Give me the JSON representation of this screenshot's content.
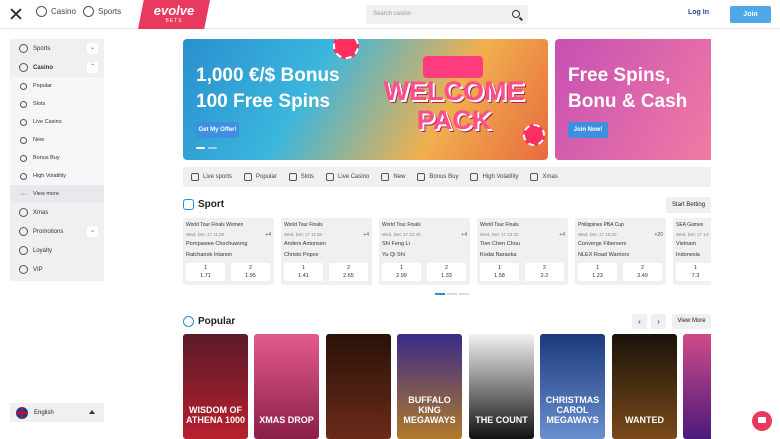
{
  "header": {
    "nav": [
      {
        "label": "Casino",
        "icon": "casino-icon"
      },
      {
        "label": "Sports",
        "icon": "sports-icon"
      }
    ],
    "logo": {
      "line1": "evolve",
      "line2": "BETS"
    },
    "search_placeholder": "Search casino",
    "login_label": "Log In",
    "join_label": "Join"
  },
  "sidebar": {
    "items": [
      {
        "label": "Sports",
        "icon": "sports-icon",
        "expand": "⌄"
      },
      {
        "label": "Casino",
        "icon": "casino-icon",
        "expand": "⌃"
      },
      {
        "label": "Popular",
        "icon": "popular-icon"
      },
      {
        "label": "Slots",
        "icon": "slots-icon"
      },
      {
        "label": "Live Casino",
        "icon": "live-casino-icon"
      },
      {
        "label": "New",
        "icon": "new-icon"
      },
      {
        "label": "Bonus Buy",
        "icon": "bonus-buy-icon"
      },
      {
        "label": "High Volatility",
        "icon": "high-volatility-icon"
      },
      {
        "label": "View more",
        "icon": "ellipsis-icon"
      },
      {
        "label": "Xmas",
        "icon": "xmas-icon"
      },
      {
        "label": "Promotions",
        "icon": "promotions-icon",
        "expand": "⌄"
      },
      {
        "label": "Loyalty",
        "icon": "loyalty-icon"
      },
      {
        "label": "VIP",
        "icon": "vip-icon"
      }
    ],
    "language": "English"
  },
  "banners": [
    {
      "title": "1,000 €/$ Bonus 100 Free Spins",
      "art": "WELCOME PACK",
      "button": "Get My Offer!"
    },
    {
      "title": "Free Spins, Bonu & Cash",
      "button": "Join Now!"
    }
  ],
  "categories": [
    {
      "label": "Live sports",
      "icon": "live-sports-icon"
    },
    {
      "label": "Popular",
      "icon": "popular-icon"
    },
    {
      "label": "Slots",
      "icon": "slots-icon"
    },
    {
      "label": "Live Casino",
      "icon": "live-casino-icon"
    },
    {
      "label": "New",
      "icon": "new-icon"
    },
    {
      "label": "Bonus Buy",
      "icon": "bonus-buy-icon"
    },
    {
      "label": "High Volatility",
      "icon": "high-volatility-icon"
    },
    {
      "label": "Xmas",
      "icon": "xmas-icon"
    }
  ],
  "sport": {
    "title": "Sport",
    "start_betting": "Start Betting",
    "matches": [
      {
        "league": "World Tour Finals Women",
        "date": "Wed, Dec 17 11:00",
        "more": "+4",
        "team1": "Pornpawee Chochuwong",
        "team2": "Ratchanok Intanon",
        "o1_label": "1",
        "o1": "1.71",
        "o2_label": "2",
        "o2": "1.95"
      },
      {
        "league": "World Tour Finals",
        "date": "Wed, Dec 17 11:50",
        "more": "+4",
        "team1": "Anders Antonsen",
        "team2": "Christo Popov",
        "o1_label": "1",
        "o1": "1.41",
        "o2_label": "2",
        "o2": "2.65"
      },
      {
        "league": "World Tour Finals",
        "date": "Wed, Dec 17 12:40",
        "more": "+4",
        "team1": "Shi Feng Li",
        "team2": "Yu Qi Shi",
        "o1_label": "1",
        "o1": "2.99",
        "o2_label": "2",
        "o2": "1.33"
      },
      {
        "league": "World Tour Finals",
        "date": "Wed, Dec 17 13:30",
        "more": "+4",
        "team1": "Tien Chen Chou",
        "team2": "Kodai Naraoka",
        "o1_label": "1",
        "o1": "1.58",
        "o2_label": "2",
        "o2": "2.2"
      },
      {
        "league": "Philippines PBA Cup",
        "date": "Wed, Dec 17 13:30",
        "more": "+20",
        "team1": "Converge Fiberxers",
        "team2": "NLEX Road Warriors",
        "o1_label": "1",
        "o1": "1.23",
        "o2_label": "2",
        "o2": "3.49"
      },
      {
        "league": "SEA Games",
        "date": "Wed, Dec 17 14:",
        "more": "",
        "team1": "Vietnam",
        "team2": "Indonesia",
        "o1_label": "1",
        "o1": "7.3",
        "o2_label": "",
        "o2": ""
      }
    ]
  },
  "popular": {
    "title": "Popular",
    "prev": "‹",
    "next": "›",
    "view_more": "View More",
    "games": [
      {
        "name": "WISDOM OF ATHENA 1000",
        "color": "#b8202e"
      },
      {
        "name": "XMAS DROP",
        "color": "#d94a7c"
      },
      {
        "name": "",
        "color": "#6a2a1a"
      },
      {
        "name": "BUFFALO KING MEGAWAYS",
        "color": "#6b3fb0"
      },
      {
        "name": "THE COUNT",
        "color": "#1e1e1e"
      },
      {
        "name": "CHRISTMAS CAROL MEGAWAYS",
        "color": "#2753a8"
      },
      {
        "name": "WANTED",
        "color": "#3a2a1a"
      },
      {
        "name": "",
        "color": "#8d3fa8"
      }
    ]
  }
}
